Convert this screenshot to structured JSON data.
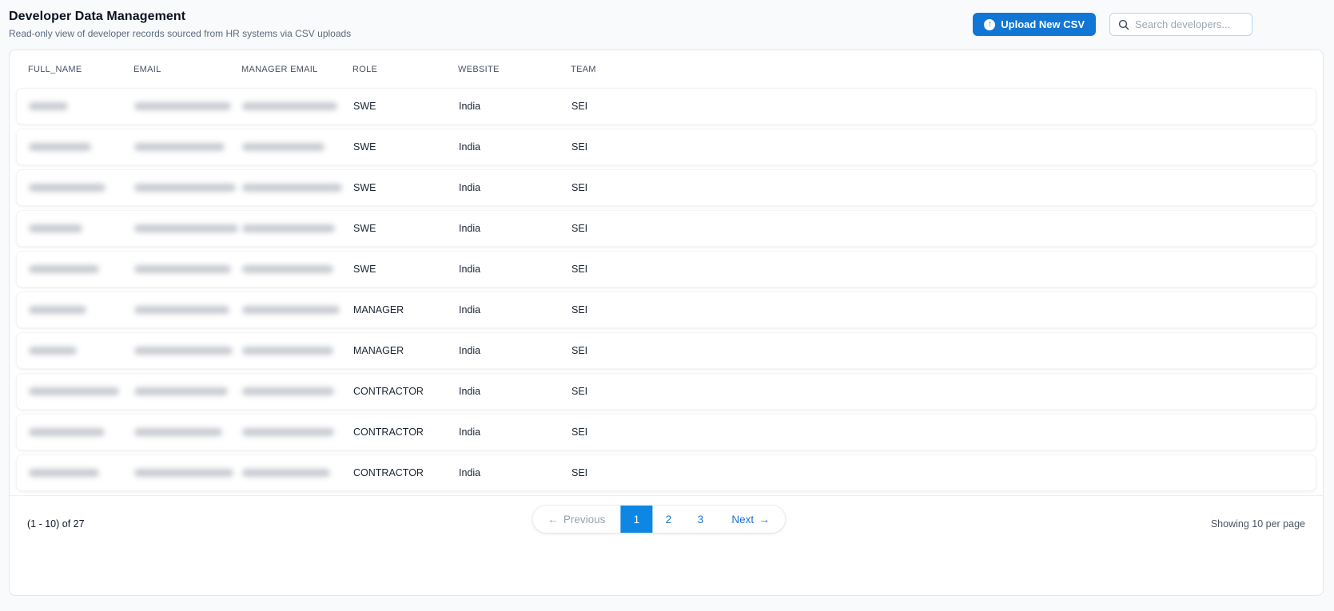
{
  "header": {
    "title": "Developer Data Management",
    "subtitle": "Read-only view of developer records sourced from HR systems via CSV uploads"
  },
  "toolbar": {
    "upload_label": "Upload New CSV",
    "upload_icon": "arrow-up-circle",
    "search_placeholder": "Search developers...",
    "search_icon": "magnifier"
  },
  "table": {
    "columns": [
      "FULL_NAME",
      "EMAIL",
      "MANAGER EMAIL",
      "ROLE",
      "WEBSITE",
      "TEAM"
    ],
    "rows": [
      {
        "role": "SWE",
        "website": "India",
        "team": "SEI",
        "redacted_widths": {
          "full_name": 49,
          "email": 121,
          "manager_email": 119
        }
      },
      {
        "role": "SWE",
        "website": "India",
        "team": "SEI",
        "redacted_widths": {
          "full_name": 78,
          "email": 113,
          "manager_email": 103
        }
      },
      {
        "role": "SWE",
        "website": "India",
        "team": "SEI",
        "redacted_widths": {
          "full_name": 96,
          "email": 127,
          "manager_email": 125
        }
      },
      {
        "role": "SWE",
        "website": "India",
        "team": "SEI",
        "redacted_widths": {
          "full_name": 67,
          "email": 130,
          "manager_email": 116
        }
      },
      {
        "role": "SWE",
        "website": "India",
        "team": "SEI",
        "redacted_widths": {
          "full_name": 88,
          "email": 121,
          "manager_email": 114
        }
      },
      {
        "role": "MANAGER",
        "website": "India",
        "team": "SEI",
        "redacted_widths": {
          "full_name": 72,
          "email": 119,
          "manager_email": 122
        }
      },
      {
        "role": "MANAGER",
        "website": "India",
        "team": "SEI",
        "redacted_widths": {
          "full_name": 60,
          "email": 123,
          "manager_email": 114
        }
      },
      {
        "role": "CONTRACTOR",
        "website": "India",
        "team": "SEI",
        "redacted_widths": {
          "full_name": 113,
          "email": 117,
          "manager_email": 115
        }
      },
      {
        "role": "CONTRACTOR",
        "website": "India",
        "team": "SEI",
        "redacted_widths": {
          "full_name": 95,
          "email": 110,
          "manager_email": 115
        }
      },
      {
        "role": "CONTRACTOR",
        "website": "India",
        "team": "SEI",
        "redacted_widths": {
          "full_name": 88,
          "email": 124,
          "manager_email": 110
        }
      }
    ]
  },
  "pagination": {
    "range_label": "(1 - 10) of 27",
    "previous_label": "Previous",
    "prev_arrow": "←",
    "pages": [
      "1",
      "2",
      "3"
    ],
    "active_page": "1",
    "next_label": "Next",
    "next_arrow": "→",
    "per_page_label": "Showing 10 per page"
  },
  "colors": {
    "accent_blue": "#1277d4",
    "active_page_blue": "#0d87e3",
    "page_background": "#f8fafc",
    "card_border": "#e2e8f0",
    "link_blue": "#1b72d9"
  }
}
